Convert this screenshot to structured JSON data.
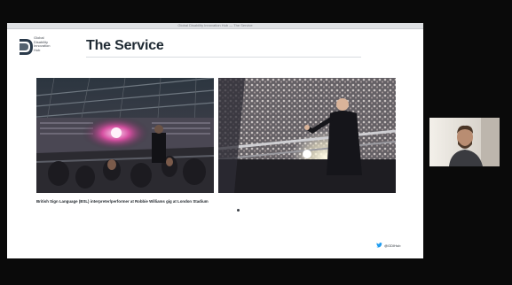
{
  "window": {
    "title": "Global Disability Innovation Hub — The Service"
  },
  "slide": {
    "logo_text": "Global Disability Innovation Hub",
    "title": "The Service",
    "caption": "British Sign Language (BSL) interpreter/performer at Robbie Williams gig at London Stadium",
    "twitter_handle": "@GDIHub"
  },
  "colors": {
    "background": "#0a0a0a",
    "slide_background": "#ffffff",
    "title_text": "#1f2a33",
    "twitter_blue": "#1d9bf0"
  },
  "icons": {
    "logo_mark": "gdi-hub-logo-icon",
    "twitter": "twitter-bird-icon"
  },
  "participant": {
    "has_video": true
  }
}
